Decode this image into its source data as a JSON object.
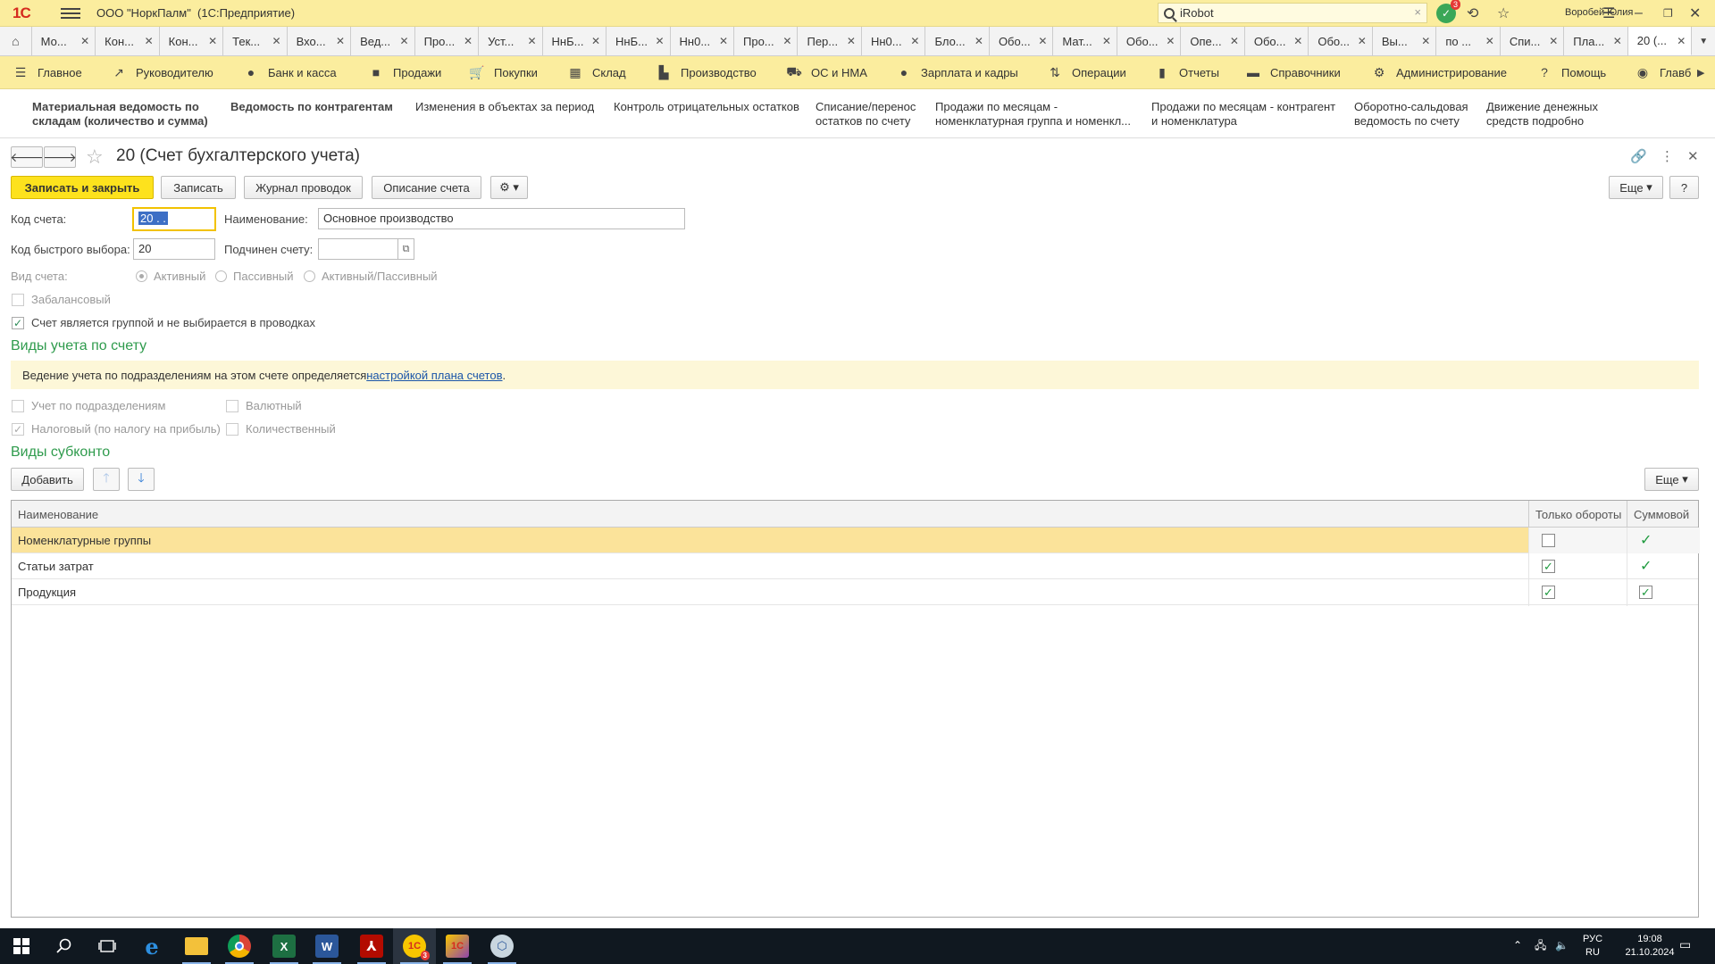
{
  "titlebar": {
    "logo": "1С",
    "app_title": "ООО \"НоркПалм\"  (1С:Предприятие)",
    "search_value": "iRobot",
    "notifications_count": "3",
    "user_name": "Воробей Юлия"
  },
  "tabs": [
    {
      "label": "Мо..."
    },
    {
      "label": "Кон..."
    },
    {
      "label": "Кон..."
    },
    {
      "label": "Тек..."
    },
    {
      "label": "Вхо..."
    },
    {
      "label": "Вед..."
    },
    {
      "label": "Про..."
    },
    {
      "label": "Уст..."
    },
    {
      "label": "НнБ..."
    },
    {
      "label": "НнБ..."
    },
    {
      "label": "Нн0..."
    },
    {
      "label": "Про..."
    },
    {
      "label": "Пер..."
    },
    {
      "label": "Нн0..."
    },
    {
      "label": "Бло..."
    },
    {
      "label": "Обо..."
    },
    {
      "label": "Мат..."
    },
    {
      "label": "Обо..."
    },
    {
      "label": "Опе..."
    },
    {
      "label": "Обо..."
    },
    {
      "label": "Обо..."
    },
    {
      "label": "Вы..."
    },
    {
      "label": "по ..."
    },
    {
      "label": "Спи..."
    },
    {
      "label": "Пла..."
    },
    {
      "label": "20 (..."
    }
  ],
  "sections": [
    {
      "label": "Главное",
      "icon": "menu-icon"
    },
    {
      "label": "Руководителю",
      "icon": "trend-icon"
    },
    {
      "label": "Банк и касса",
      "icon": "coin-icon"
    },
    {
      "label": "Продажи",
      "icon": "bag-icon"
    },
    {
      "label": "Покупки",
      "icon": "cart-icon"
    },
    {
      "label": "Склад",
      "icon": "grid-icon"
    },
    {
      "label": "Производство",
      "icon": "factory-icon"
    },
    {
      "label": "ОС и НМА",
      "icon": "truck-icon"
    },
    {
      "label": "Зарплата и кадры",
      "icon": "person-icon"
    },
    {
      "label": "Операции",
      "icon": "ops-icon"
    },
    {
      "label": "Отчеты",
      "icon": "bar-chart-icon"
    },
    {
      "label": "Справочники",
      "icon": "book-icon"
    },
    {
      "label": "Администрирование",
      "icon": "gear-icon"
    },
    {
      "label": "Помощь",
      "icon": "question-icon"
    },
    {
      "label": "Главб",
      "icon": "globe-icon"
    }
  ],
  "commands": [
    "Материальная ведомость по складам (количество и сумма)",
    "Ведомость по контрагентам",
    "Изменения в объектах за период",
    "Контроль отрицательных остатков",
    "Списание/перенос остатков по счету",
    "Продажи по месяцам - номенклатурная группа и номенкл...",
    "Продажи по месяцам - контрагент и номенклатура",
    "Оборотно-сальдовая ведомость по счету",
    "Движение денежных средств подробно"
  ],
  "form": {
    "title": "20 (Счет бухгалтерского учета)",
    "btn_save_close": "Записать и закрыть",
    "btn_save": "Записать",
    "btn_journal": "Журнал проводок",
    "btn_description": "Описание счета",
    "btn_more": "Еще",
    "btn_help": "?",
    "code_label": "Код счета:",
    "code_value": "20 . .",
    "name_label": "Наименование:",
    "name_value": "Основное производство",
    "quick_code_label": "Код быстрого выбора:",
    "quick_code_value": "20",
    "parent_label": "Подчинен счету:",
    "parent_value": "",
    "type_label": "Вид счета:",
    "type_active": "Активный",
    "type_passive": "Пассивный",
    "type_active_passive": "Активный/Пассивный",
    "offbalance": "Забалансовый",
    "is_group": "Счет является группой и не выбирается в проводках",
    "accounting_types_title": "Виды учета по счету",
    "info_text": "Ведение учета по подразделениям на этом счете определяется ",
    "info_link": "настройкой плана счетов",
    "info_tail": ".",
    "by_departments": "Учет по подразделениям",
    "currency": "Валютный",
    "tax": "Налоговый (по налогу на прибыль)",
    "quantity": "Количественный",
    "subconto_title": "Виды субконто",
    "btn_add": "Добавить",
    "btn_more2": "Еще"
  },
  "table": {
    "columns": [
      "Наименование",
      "Только обороты",
      "Суммовой"
    ],
    "rows": [
      {
        "name": "Номенклатурные группы",
        "turnover_only": false,
        "sum": true
      },
      {
        "name": "Статьи затрат",
        "turnover_only": true,
        "sum": true
      },
      {
        "name": "Продукция",
        "turnover_only": true,
        "sum": true
      }
    ]
  },
  "taskbar": {
    "lang_top": "РУС",
    "lang_bottom": "RU",
    "time": "19:08",
    "date": "21.10.2024",
    "onec_badge": "3"
  }
}
